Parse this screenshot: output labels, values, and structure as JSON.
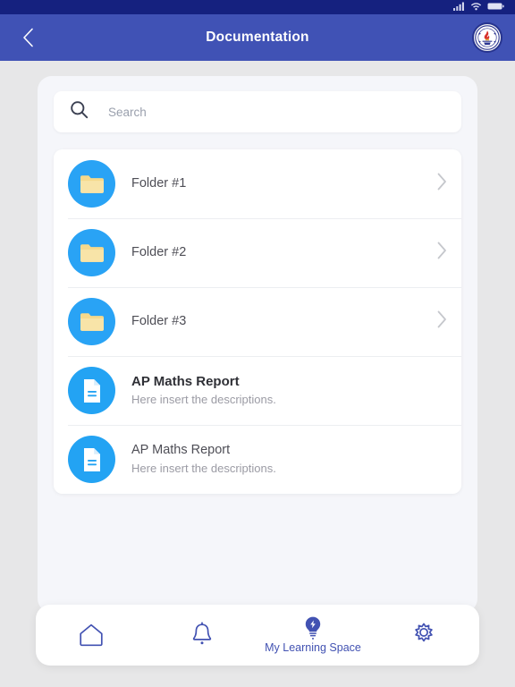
{
  "status_bar": {
    "background": "#15217F",
    "icons": [
      "signal-bars-icon",
      "wifi-icon",
      "battery-icon"
    ]
  },
  "app_bar": {
    "background": "#4052B5",
    "title": "Documentation",
    "back_label": "Back",
    "logo_label": "Institution Crest"
  },
  "search": {
    "placeholder": "Search",
    "value": "",
    "icon": "search-icon"
  },
  "list": [
    {
      "type": "folder",
      "icon": "folder-icon",
      "avatar_color": "#29A3F5",
      "title": "Folder #1",
      "subtitle": "",
      "has_chevron": true,
      "emphasis": false
    },
    {
      "type": "folder",
      "icon": "folder-icon",
      "avatar_color": "#29A3F5",
      "title": "Folder #2",
      "subtitle": "",
      "has_chevron": true,
      "emphasis": false
    },
    {
      "type": "folder",
      "icon": "folder-icon",
      "avatar_color": "#29A3F5",
      "title": "Folder #3",
      "subtitle": "",
      "has_chevron": true,
      "emphasis": false
    },
    {
      "type": "document",
      "icon": "document-icon",
      "avatar_color": "#23A3F3",
      "title": "AP Maths Report",
      "subtitle": "Here insert the descriptions.",
      "has_chevron": false,
      "emphasis": true
    },
    {
      "type": "document",
      "icon": "document-icon",
      "avatar_color": "#23A3F3",
      "title": "AP Maths Report",
      "subtitle": "Here insert the descriptions.",
      "has_chevron": false,
      "emphasis": false
    }
  ],
  "bottom_nav": {
    "accent": "#4252B2",
    "items": [
      {
        "icon": "home-icon",
        "label": "",
        "active": false
      },
      {
        "icon": "bell-icon",
        "label": "",
        "active": false
      },
      {
        "icon": "lightbulb-icon",
        "label": "My Learning Space",
        "active": true
      },
      {
        "icon": "gear-icon",
        "label": "",
        "active": false
      }
    ]
  }
}
